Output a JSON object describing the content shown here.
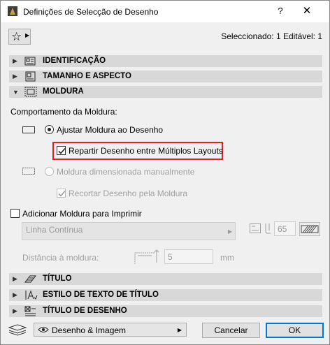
{
  "window": {
    "title": "Definições de Selecção de Desenho",
    "help": "?",
    "close": "✕"
  },
  "header": {
    "selection_info": "Seleccionado: 1 Editável: 1"
  },
  "panels": [
    {
      "label": "IDENTIFICAÇÃO",
      "icon": "id-info-icon",
      "expanded": false
    },
    {
      "label": "TAMANHO E ASPECTO",
      "icon": "size-appearance-icon",
      "expanded": false
    },
    {
      "label": "MOLDURA",
      "icon": "frame-icon",
      "expanded": true
    },
    {
      "label": "TÍTULO",
      "icon": "title-icon",
      "expanded": false
    },
    {
      "label": "ESTILO DE TEXTO DE TÍTULO",
      "icon": "text-style-icon",
      "expanded": false
    },
    {
      "label": "TÍTULO DE DESENHO",
      "icon": "drawing-title-icon",
      "expanded": false
    }
  ],
  "frame": {
    "behavior_label": "Comportamento da Moldura:",
    "fit_label": "Ajustar Moldura ao Desenho",
    "fit_selected": true,
    "split_label": "Repartir Desenho entre Múltiplos Layouts",
    "split_checked": true,
    "manual_label": "Moldura dimensionada manualmente",
    "manual_selected": false,
    "crop_label": "Recortar Desenho pela Moldura",
    "crop_checked": true,
    "add_print_label": "Adicionar Moldura para Imprimir",
    "add_print_checked": false,
    "line_type": "Linha Contínua",
    "pen_number": "65",
    "distance_label": "Distância à moldura:",
    "distance_value": "5",
    "distance_unit": "mm"
  },
  "footer": {
    "view_option": "Desenho & Imagem",
    "cancel_label": "Cancelar",
    "ok_label": "OK"
  },
  "colors": {
    "panel_bg": "#d8d8d8",
    "highlight_border": "#e0202a",
    "default_button_border": "#0078d7"
  }
}
